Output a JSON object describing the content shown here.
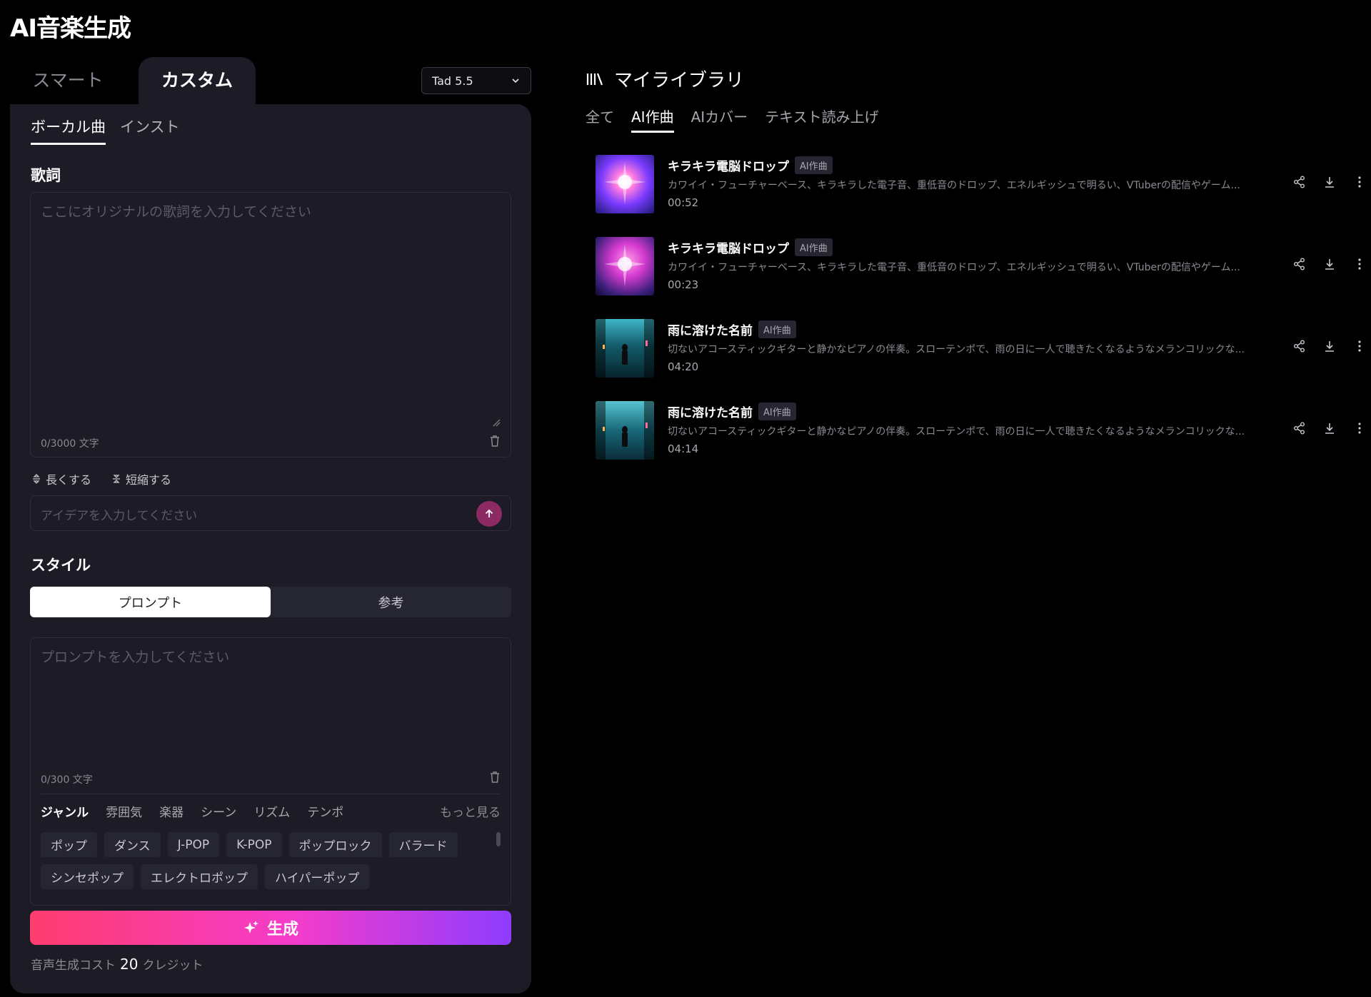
{
  "app_title": "AI音楽生成",
  "mode_tabs": {
    "smart": "スマート",
    "custom": "カスタム"
  },
  "model_select": {
    "value": "Tad 5.5"
  },
  "sub_tabs": {
    "vocal": "ボーカル曲",
    "instrumental": "インスト"
  },
  "lyrics": {
    "label": "歌詞",
    "placeholder": "ここにオリジナルの歌詞を入力してください",
    "counter": "0/3000 文字"
  },
  "ai_actions": {
    "lengthen": "長くする",
    "shorten": "短縮する"
  },
  "idea_input": {
    "placeholder": "アイデアを入力してください"
  },
  "style": {
    "label": "スタイル",
    "segments": [
      "プロンプト",
      "参考"
    ],
    "prompt_placeholder": "プロンプトを入力してください",
    "counter": "0/300 文字",
    "categories": [
      "ジャンル",
      "雰囲気",
      "楽器",
      "シーン",
      "リズム",
      "テンポ"
    ],
    "more": "もっと見る",
    "chips": [
      "ポップ",
      "ダンス",
      "J-POP",
      "K-POP",
      "ポップロック",
      "バラード",
      "シンセポップ",
      "エレクトロポップ",
      "ハイパーポップ"
    ]
  },
  "generate": {
    "label": "生成"
  },
  "cost": {
    "prefix": "音声生成コスト",
    "value": "20",
    "suffix": "クレジット"
  },
  "library": {
    "title": "マイライブラリ",
    "tabs": [
      "全て",
      "AI作曲",
      "AIカバー",
      "テキスト読み上げ"
    ],
    "tracks": [
      {
        "title": "キラキラ電脳ドロップ",
        "badge": "AI作曲",
        "desc": "カワイイ・フューチャーベース、キラキラした電子音、重低音のドロップ、エネルギッシュで明るい、VTuberの配信やゲーム...",
        "duration": "00:52"
      },
      {
        "title": "キラキラ電脳ドロップ",
        "badge": "AI作曲",
        "desc": "カワイイ・フューチャーベース、キラキラした電子音、重低音のドロップ、エネルギッシュで明るい、VTuberの配信やゲーム...",
        "duration": "00:23"
      },
      {
        "title": "雨に溶けた名前",
        "badge": "AI作曲",
        "desc": "切ないアコースティックギターと静かなピアノの伴奏。スローテンポで、雨の日に一人で聴きたくなるようなメランコリックな...",
        "duration": "04:20"
      },
      {
        "title": "雨に溶けた名前",
        "badge": "AI作曲",
        "desc": "切ないアコースティックギターと静かなピアノの伴奏。スローテンポで、雨の日に一人で聴きたくなるようなメランコリックな...",
        "duration": "04:14"
      }
    ]
  },
  "colors": {
    "accent_gradient_start": "#ff3d6e",
    "accent_gradient_mid": "#f43ccb",
    "accent_gradient_end": "#8e3dff",
    "panel_bg": "#1c1b26"
  }
}
